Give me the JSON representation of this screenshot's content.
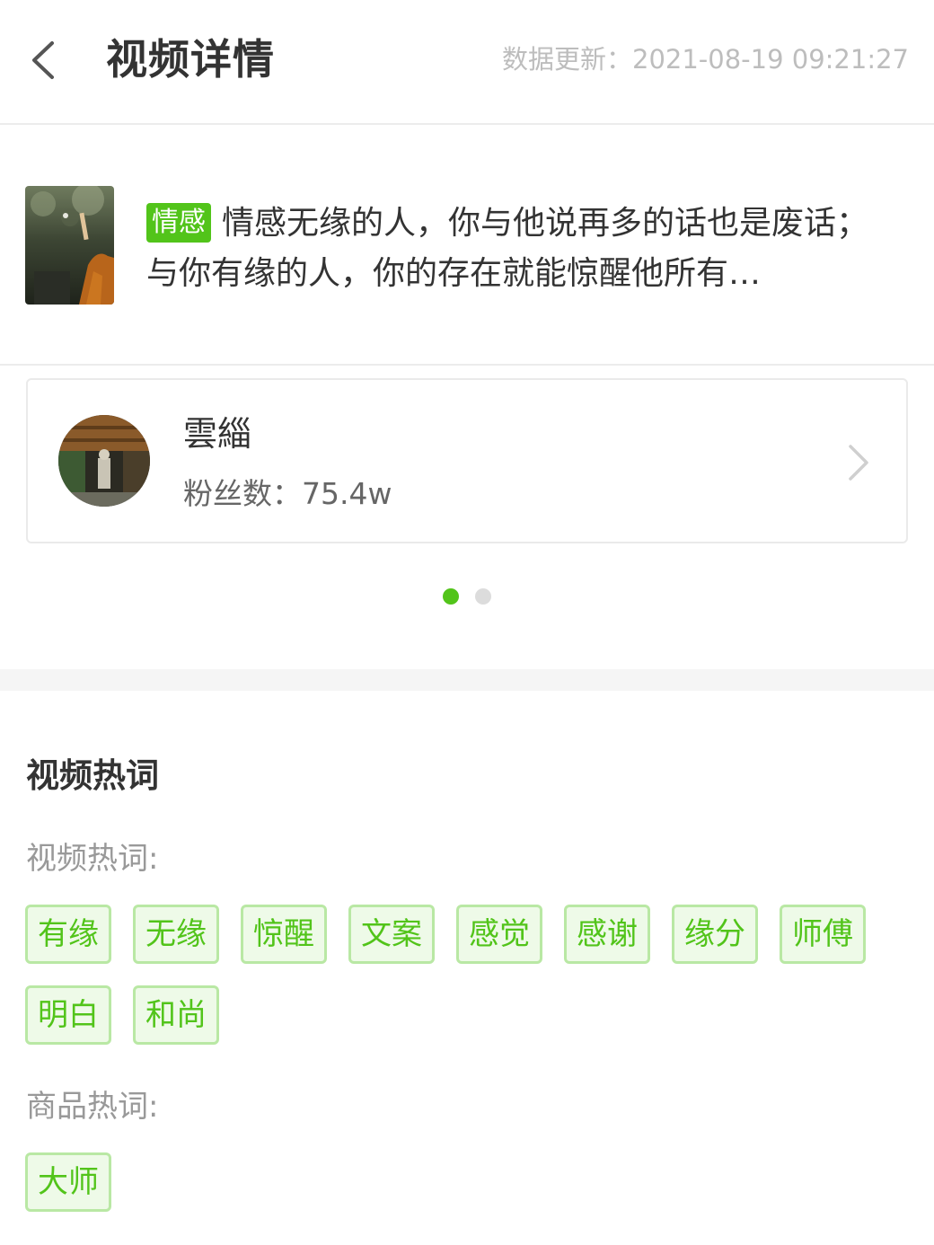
{
  "header": {
    "title": "视频详情",
    "update_time": "数据更新：2021-08-19 09:21:27",
    "back_icon": "chevron-left-icon"
  },
  "video": {
    "category_tag": "情感",
    "description": "情感无缘的人，你与他说再多的话也是废话；与你有缘的人，你的存在就能惊醒他所有…"
  },
  "author": {
    "name": "雲緇",
    "fans": "粉丝数：75.4w"
  },
  "carousel": {
    "active_index": 0,
    "count": 2,
    "active_color": "#52c41a",
    "inactive_color": "#dcdcdc"
  },
  "hotwords": {
    "title": "视频热词",
    "video_label": "视频热词:",
    "video_words": [
      "有缘",
      "无缘",
      "惊醒",
      "文案",
      "感觉",
      "感谢",
      "缘分",
      "师傅",
      "明白",
      "和尚"
    ],
    "product_label": "商品热词:",
    "product_words": [
      "大师"
    ]
  },
  "colors": {
    "accent": "#52c41a",
    "chip_border": "#b9e8a4",
    "chip_bg": "#eefae8"
  }
}
